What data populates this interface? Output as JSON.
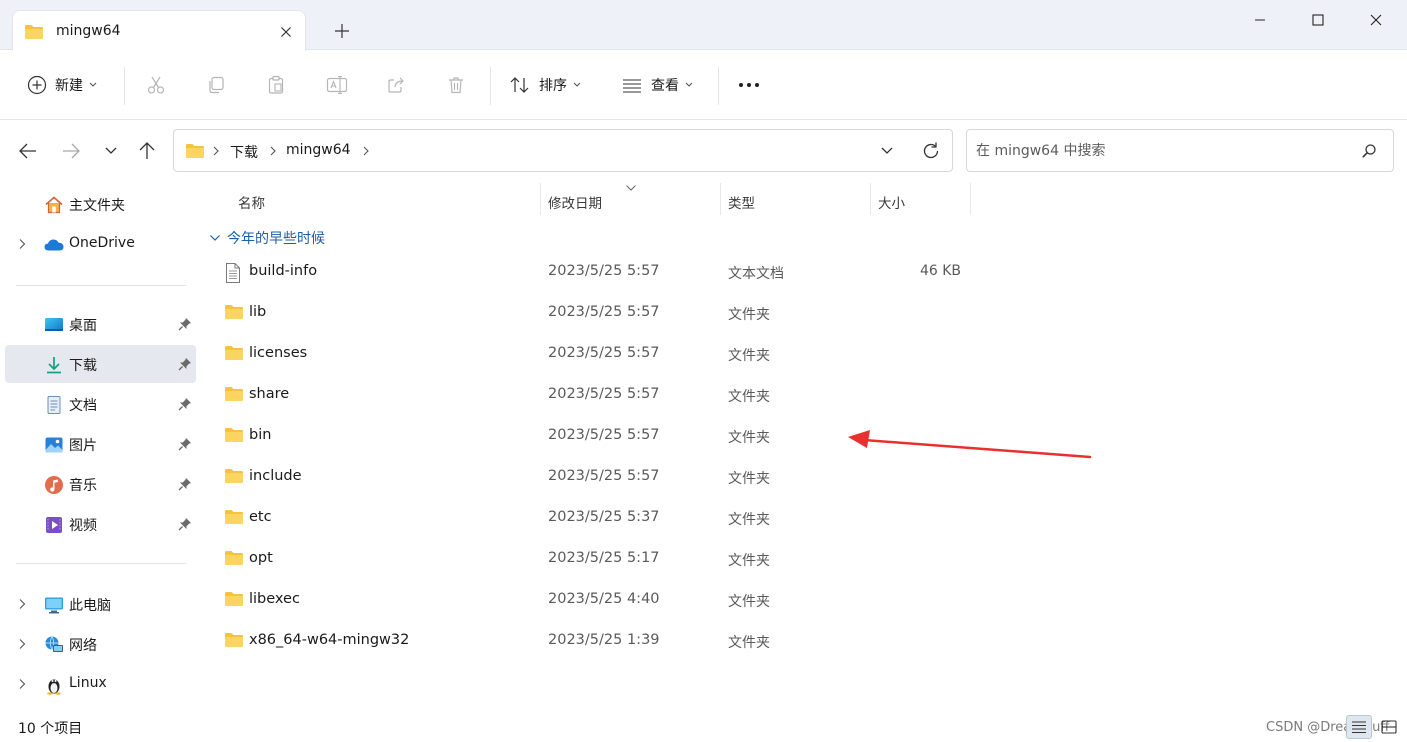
{
  "window": {
    "tab_title": "mingw64",
    "colors": {
      "accent": "#0067c0",
      "folder": "#f5c244",
      "selected_bg": "#e5e8ee",
      "annotation_arrow": "#e8312f"
    }
  },
  "toolbar": {
    "new_label": "新建",
    "sort_label": "排序",
    "view_label": "查看"
  },
  "address": {
    "crumbs": [
      "下载",
      "mingw64"
    ]
  },
  "search": {
    "placeholder": "在 mingw64 中搜索"
  },
  "sidebar": {
    "items": [
      {
        "label": "主文件夹",
        "icon": "home-icon"
      },
      {
        "label": "OneDrive",
        "icon": "onedrive-icon"
      },
      {
        "label": "桌面",
        "icon": "desktop-icon",
        "pinned": true
      },
      {
        "label": "下载",
        "icon": "download-icon",
        "pinned": true,
        "selected": true
      },
      {
        "label": "文档",
        "icon": "document-icon",
        "pinned": true
      },
      {
        "label": "图片",
        "icon": "pictures-icon",
        "pinned": true
      },
      {
        "label": "音乐",
        "icon": "music-icon",
        "pinned": true
      },
      {
        "label": "视频",
        "icon": "video-icon",
        "pinned": true
      },
      {
        "label": "此电脑",
        "icon": "this-pc-icon"
      },
      {
        "label": "网络",
        "icon": "network-icon"
      },
      {
        "label": "Linux",
        "icon": "linux-icon"
      }
    ]
  },
  "columns": {
    "name": "名称",
    "date": "修改日期",
    "type": "类型",
    "size": "大小"
  },
  "group": {
    "label": "今年的早些时候"
  },
  "files": [
    {
      "name": "build-info",
      "date": "2023/5/25 5:57",
      "type": "文本文档",
      "size": "46 KB",
      "icon": "text-file-icon"
    },
    {
      "name": "lib",
      "date": "2023/5/25 5:57",
      "type": "文件夹",
      "size": "",
      "icon": "folder-icon"
    },
    {
      "name": "licenses",
      "date": "2023/5/25 5:57",
      "type": "文件夹",
      "size": "",
      "icon": "folder-icon"
    },
    {
      "name": "share",
      "date": "2023/5/25 5:57",
      "type": "文件夹",
      "size": "",
      "icon": "folder-icon"
    },
    {
      "name": "bin",
      "date": "2023/5/25 5:57",
      "type": "文件夹",
      "size": "",
      "icon": "folder-icon"
    },
    {
      "name": "include",
      "date": "2023/5/25 5:57",
      "type": "文件夹",
      "size": "",
      "icon": "folder-icon"
    },
    {
      "name": "etc",
      "date": "2023/5/25 5:37",
      "type": "文件夹",
      "size": "",
      "icon": "folder-icon"
    },
    {
      "name": "opt",
      "date": "2023/5/25 5:17",
      "type": "文件夹",
      "size": "",
      "icon": "folder-icon"
    },
    {
      "name": "libexec",
      "date": "2023/5/25 4:40",
      "type": "文件夹",
      "size": "",
      "icon": "folder-icon"
    },
    {
      "name": "x86_64-w64-mingw32",
      "date": "2023/5/25 1:39",
      "type": "文件夹",
      "size": "",
      "icon": "folder-icon"
    }
  ],
  "status": {
    "item_count": "10 个项目",
    "watermark": "CSDN @DreamSuff"
  }
}
